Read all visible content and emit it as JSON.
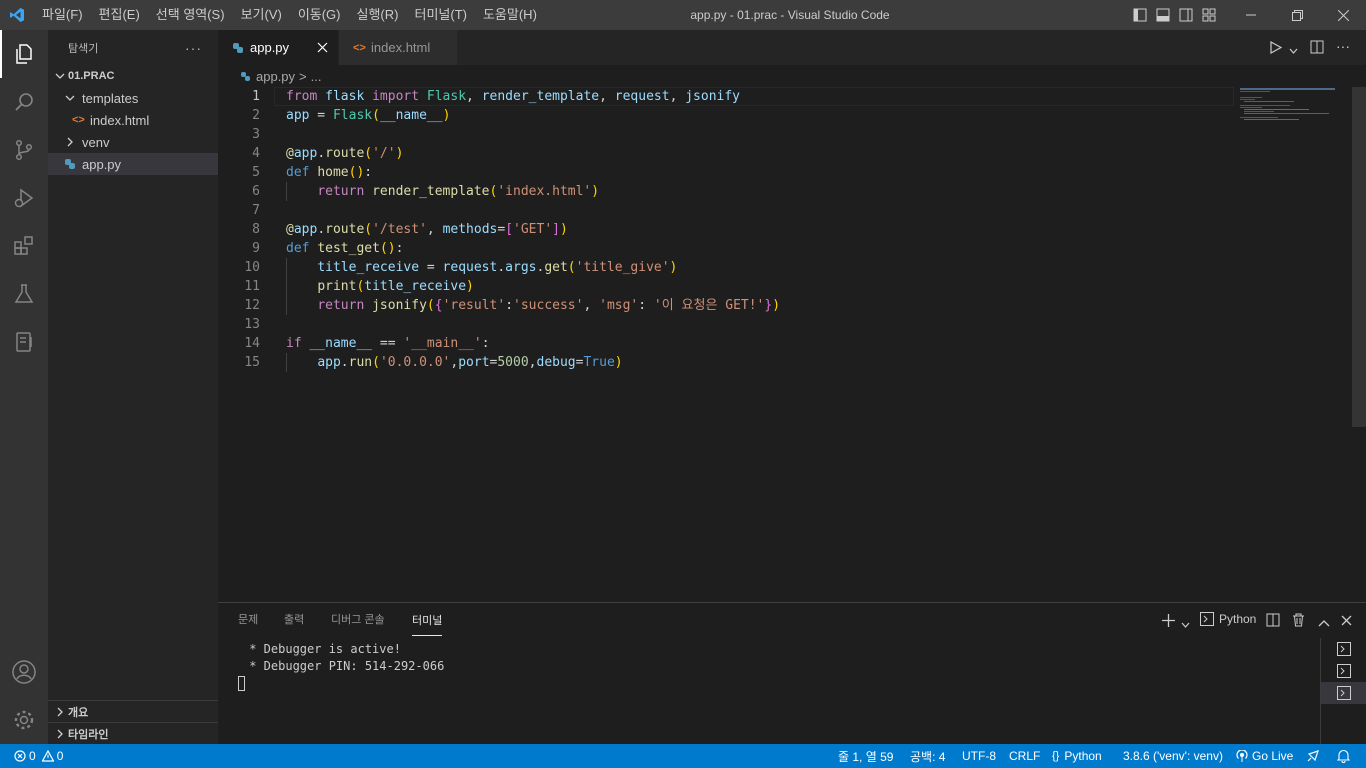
{
  "titlebar": {
    "menu": [
      "파일(F)",
      "편집(E)",
      "선택 영역(S)",
      "보기(V)",
      "이동(G)",
      "실행(R)",
      "터미널(T)",
      "도움말(H)"
    ],
    "window_title": "app.py - 01.prac - Visual Studio Code"
  },
  "sidebar": {
    "title": "탐색기",
    "more": "···",
    "root": "01.PRAC",
    "items": [
      {
        "label": "templates",
        "icon": "folder-open-chevron"
      },
      {
        "label": "index.html",
        "icon": "html-icon"
      },
      {
        "label": "venv",
        "icon": "folder-closed-chevron"
      },
      {
        "label": "app.py",
        "icon": "python-icon"
      }
    ],
    "outline": "개요",
    "timeline": "타임라인"
  },
  "tabs": [
    {
      "label": "app.py",
      "active": true
    },
    {
      "label": "index.html",
      "active": false
    }
  ],
  "breadcrumb": {
    "file": "app.py",
    "sep": ">",
    "rest": "..."
  },
  "editor": {
    "line_numbers": [
      "1",
      "2",
      "3",
      "4",
      "5",
      "6",
      "7",
      "8",
      "9",
      "10",
      "11",
      "12",
      "13",
      "14",
      "15"
    ],
    "lines": [
      "from flask import Flask, render_template, request, jsonify",
      "app = Flask(__name__)",
      "",
      "@app.route('/')",
      "def home():",
      "    return render_template('index.html')",
      "",
      "@app.route('/test', methods=['GET'])",
      "def test_get():",
      "    title_receive = request.args.get('title_give')",
      "    print(title_receive)",
      "    return jsonify({'result':'success', 'msg': '이 요청은 GET!'})",
      "",
      "if __name__ == '__main__':",
      "    app.run('0.0.0.0',port=5000,debug=True)"
    ]
  },
  "panel": {
    "tabs": [
      "문제",
      "출력",
      "디버그 콘솔",
      "터미널"
    ],
    "active_tab": "터미널",
    "shell": "Python",
    "terminal_lines": [
      " * Debugger is active!",
      " * Debugger PIN: 514-292-066"
    ]
  },
  "status": {
    "errors": "0",
    "warnings": "0",
    "position": "줄 1, 열 59",
    "spaces": "공백: 4",
    "encoding": "UTF-8",
    "eol": "CRLF",
    "language": "Python",
    "interpreter": "3.8.6 ('venv': venv)",
    "golive": "Go Live"
  },
  "colors": {
    "accent": "#007acc",
    "activity": "#333333",
    "sidebar": "#252526",
    "editor": "#1e1e1e"
  }
}
